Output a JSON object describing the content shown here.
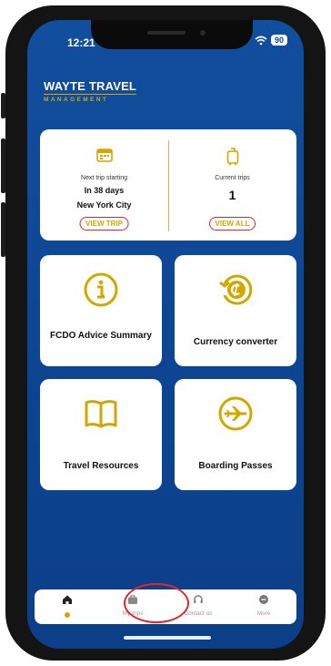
{
  "status": {
    "time": "12:21",
    "battery": "90"
  },
  "brand": {
    "name": "WAYTE TRAVEL",
    "tagline": "MANAGEMENT"
  },
  "next_trip": {
    "label": "Next trip starting",
    "days": "In 38 days",
    "city": "New York City",
    "action": "VIEW TRIP"
  },
  "current_trips": {
    "label": "Current trips",
    "count": "1",
    "action": "VIEW ALL"
  },
  "tiles": [
    {
      "label": "FCDO Advice Summary",
      "icon": "info-icon"
    },
    {
      "label": "Currency converter",
      "icon": "currency-exchange-icon"
    },
    {
      "label": "Travel Resources",
      "icon": "book-icon"
    },
    {
      "label": "Boarding Passes",
      "icon": "airplane-icon"
    }
  ],
  "tabs": [
    {
      "label": "",
      "icon": "home-icon",
      "active": true
    },
    {
      "label": "My trips",
      "icon": "briefcase-icon"
    },
    {
      "label": "Contact us",
      "icon": "headset-icon"
    },
    {
      "label": "More",
      "icon": "more-icon"
    }
  ],
  "colors": {
    "primary": "#0f4899",
    "accent": "#d3a600",
    "highlight": "#e0262b"
  }
}
